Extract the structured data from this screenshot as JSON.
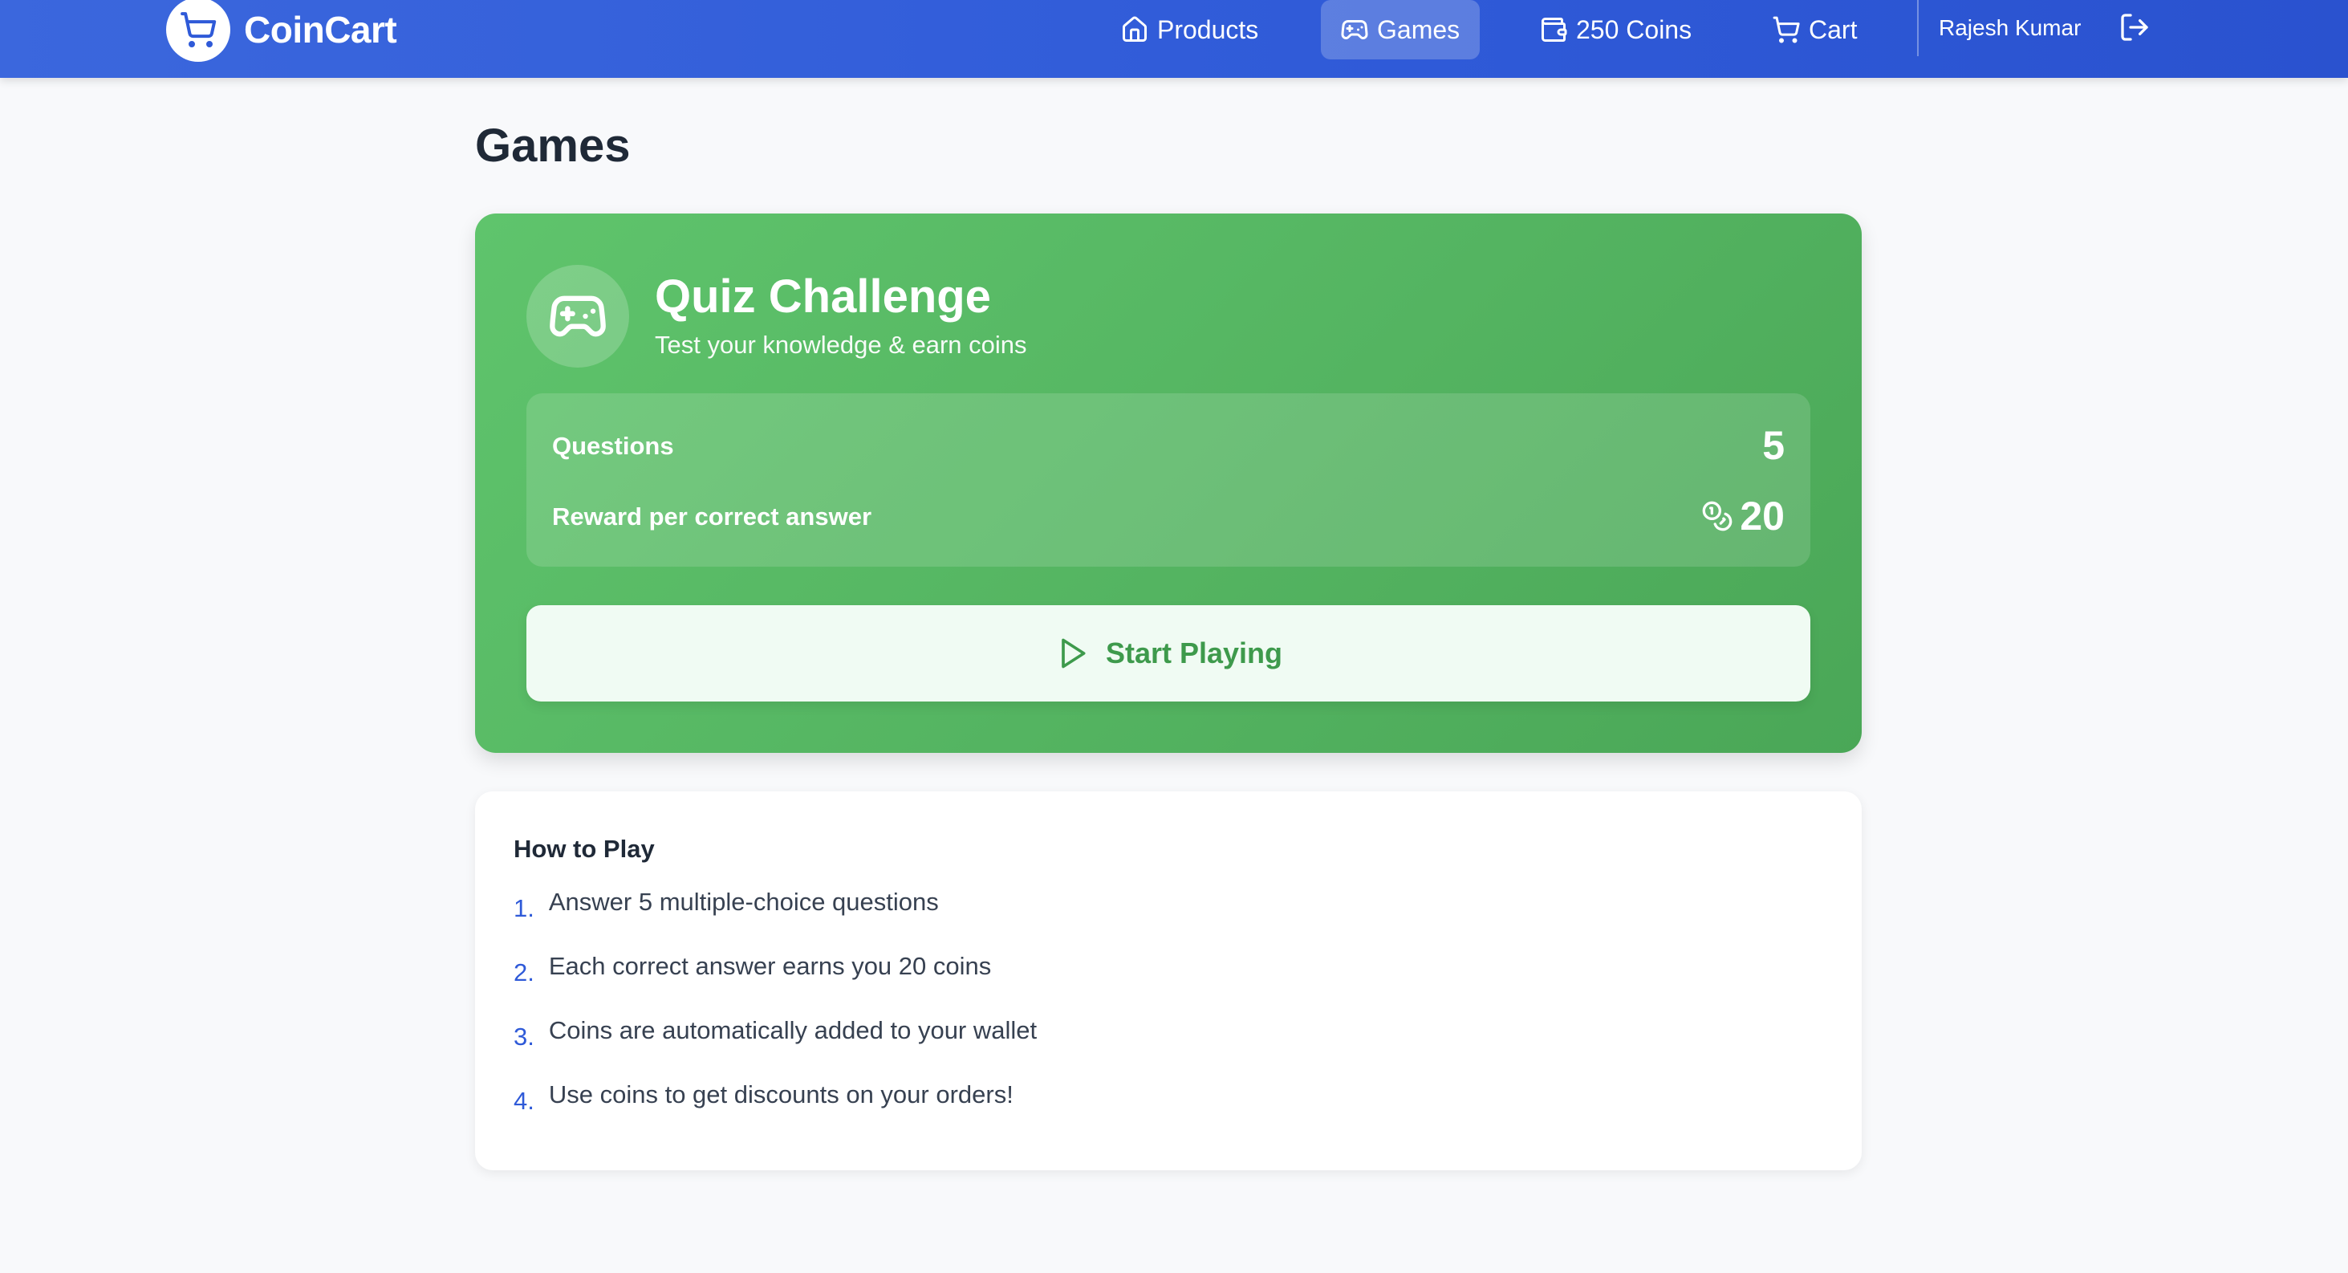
{
  "header": {
    "brand": "CoinCart",
    "nav": [
      {
        "label": "Products",
        "icon": "home-icon"
      },
      {
        "label": "Games",
        "icon": "gamepad-icon",
        "active": true
      },
      {
        "label": "250 Coins",
        "icon": "wallet-icon"
      },
      {
        "label": "Cart",
        "icon": "cart-icon"
      }
    ],
    "user": "Rajesh Kumar"
  },
  "page": {
    "title": "Games"
  },
  "game": {
    "title": "Quiz Challenge",
    "subtitle": "Test your knowledge & earn coins",
    "stats": {
      "questions_label": "Questions",
      "questions_value": "5",
      "reward_label": "Reward per correct answer",
      "reward_value": "20"
    },
    "start_label": "Start Playing"
  },
  "how_to_play": {
    "title": "How to Play",
    "steps": [
      {
        "num": "1.",
        "text": "Answer 5 multiple-choice questions"
      },
      {
        "num": "2.",
        "text": "Each correct answer earns you 20 coins"
      },
      {
        "num": "3.",
        "text": "Coins are automatically added to your wallet"
      },
      {
        "num": "4.",
        "text": "Use coins to get discounts on your orders!"
      }
    ]
  },
  "colors": {
    "header": "#2f5ad8",
    "card_green": "#54b461",
    "start_text": "#3e9a4c",
    "page_bg": "#f8f9fb"
  }
}
